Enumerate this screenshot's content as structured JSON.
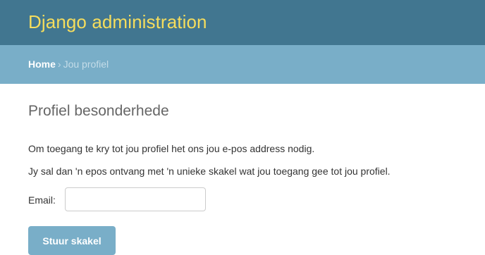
{
  "header": {
    "site_title": "Django administration"
  },
  "breadcrumbs": {
    "home_label": "Home",
    "separator": "›",
    "current": "Jou profiel"
  },
  "main": {
    "title": "Profiel besonderhede",
    "paragraph_1": "Om toegang te kry tot jou profiel het ons jou e-pos address nodig.",
    "paragraph_2": "Jy sal dan 'n epos ontvang met 'n unieke skakel wat jou toegang gee tot jou profiel.",
    "email_label": "Email:",
    "email_value": "",
    "submit_label": "Stuur skakel"
  },
  "colors": {
    "header_bg": "#417690",
    "branding_text": "#f5dd5d",
    "breadcrumbs_bg": "#79aec8",
    "button_bg": "#79aec8"
  }
}
